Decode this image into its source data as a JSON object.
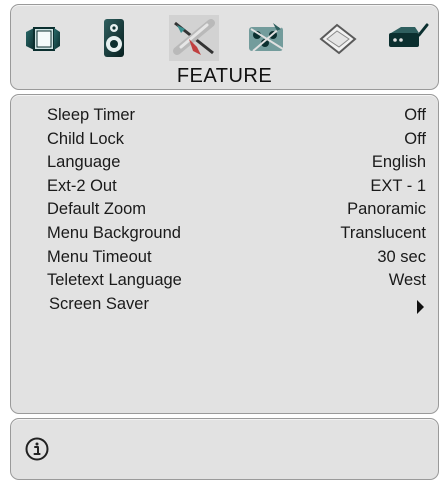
{
  "header": {
    "title": "FEATURE",
    "icons": [
      {
        "name": "picture-icon"
      },
      {
        "name": "sound-icon"
      },
      {
        "name": "feature-icon"
      },
      {
        "name": "setup-icon"
      },
      {
        "name": "source-icon"
      },
      {
        "name": "channel-icon"
      }
    ],
    "selected_icon": "feature-icon"
  },
  "menu": {
    "items": [
      {
        "label": "Sleep Timer",
        "value": "Off"
      },
      {
        "label": "Child Lock",
        "value": "Off"
      },
      {
        "label": "Language",
        "value": "English"
      },
      {
        "label": "Ext-2 Out",
        "value": "EXT - 1"
      },
      {
        "label": "Default Zoom",
        "value": "Panoramic"
      },
      {
        "label": "Menu Background",
        "value": "Translucent"
      },
      {
        "label": "Menu Timeout",
        "value": "30 sec"
      },
      {
        "label": "Teletext Language",
        "value": "West"
      },
      {
        "label": "Screen Saver",
        "value": ""
      }
    ]
  },
  "info": {
    "icon": "info-icon"
  },
  "colors": {
    "panel": "#e2e2e2",
    "border": "#9a9a9a",
    "text": "#1a1a1a"
  }
}
